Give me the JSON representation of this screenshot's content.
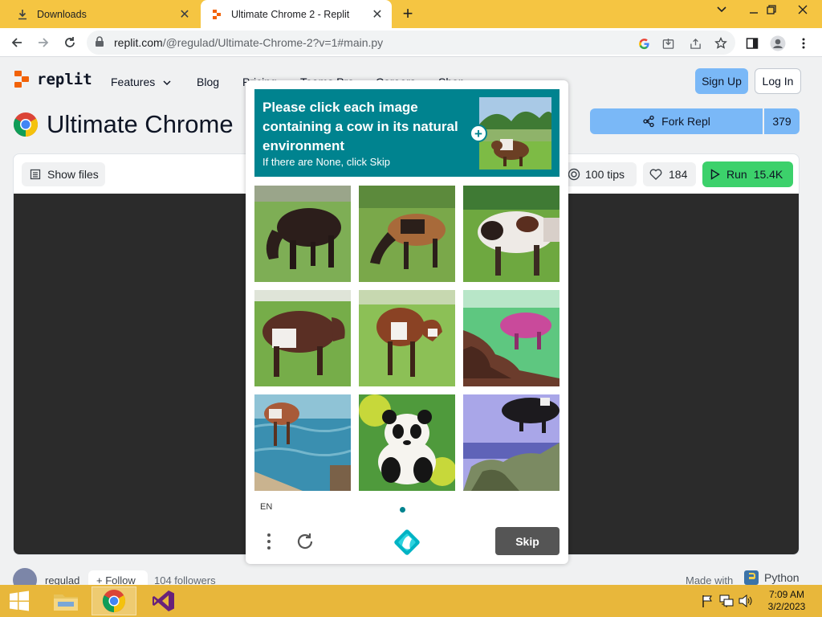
{
  "browser": {
    "tabs": [
      {
        "label": "Downloads",
        "active": false
      },
      {
        "label": "Ultimate Chrome 2 - Replit",
        "active": true
      }
    ],
    "url_host": "replit.com",
    "url_path": "/@regulad/Ultimate-Chrome-2?v=1#main.py"
  },
  "site": {
    "logo_text": "replit",
    "nav": {
      "features": "Features",
      "blog": "Blog",
      "pricing": "Pricing",
      "teams": "Teams Pro",
      "careers": "Careers",
      "shop": "Shop"
    },
    "signup": "Sign Up",
    "login": "Log In"
  },
  "repl": {
    "title": "Ultimate Chrome",
    "fork_label": "Fork Repl",
    "fork_count": "379",
    "show_files": "Show files",
    "tips": "100 tips",
    "likes": "184",
    "run_label": "Run",
    "run_count": "15.4K",
    "user": "regulad",
    "follow": "Follow",
    "followers": "104 followers",
    "made_with": "Made with",
    "language": "Python"
  },
  "captcha": {
    "prompt": "Please click each image containing a cow in its natural environment",
    "sub": "If there are None, click Skip",
    "language": "EN",
    "skip": "Skip",
    "accent": "#00838f",
    "tiles": [
      "cow-grazing",
      "cow-grazing",
      "cow-grazing",
      "cow-standing",
      "cow-standing",
      "pink-cow-distorted",
      "cow-in-water",
      "panda",
      "cow-on-rocks"
    ]
  },
  "taskbar": {
    "time": "7:09 AM",
    "date": "3/2/2023"
  },
  "colors": {
    "tabstrip": "#f5c542",
    "taskbar": "#e8b73b",
    "replit_blue": "#7ab8f7",
    "run_green": "#3cd16b"
  }
}
